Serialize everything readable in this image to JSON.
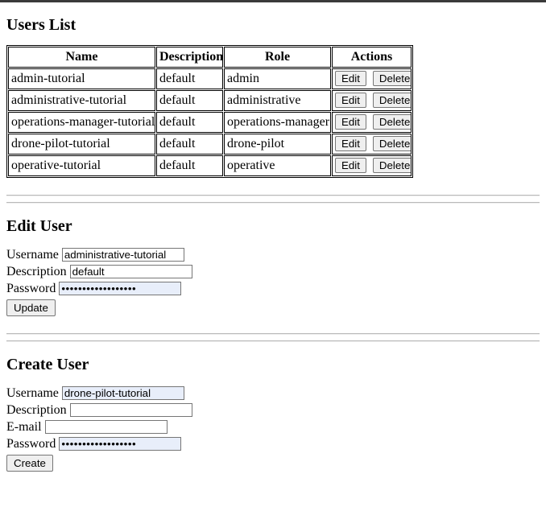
{
  "users_list": {
    "title": "Users List",
    "columns": [
      "Name",
      "Description",
      "Role",
      "Actions"
    ],
    "rows": [
      {
        "name": "admin-tutorial",
        "description": "default",
        "role": "admin",
        "edit_label": "Edit",
        "delete_label": "Delete"
      },
      {
        "name": "administrative-tutorial",
        "description": "default",
        "role": "administrative",
        "edit_label": "Edit",
        "delete_label": "Delete"
      },
      {
        "name": "operations-manager-tutorial",
        "description": "default",
        "role": "operations-manager",
        "edit_label": "Edit",
        "delete_label": "Delete"
      },
      {
        "name": "drone-pilot-tutorial",
        "description": "default",
        "role": "drone-pilot",
        "edit_label": "Edit",
        "delete_label": "Delete"
      },
      {
        "name": "operative-tutorial",
        "description": "default",
        "role": "operative",
        "edit_label": "Edit",
        "delete_label": "Delete"
      }
    ]
  },
  "edit_user": {
    "title": "Edit User",
    "fields": {
      "username": {
        "label": "Username",
        "value": "administrative-tutorial",
        "placeholder": ""
      },
      "description": {
        "label": "Description",
        "value": "default",
        "placeholder": ""
      },
      "password": {
        "label": "Password",
        "value": "••••••••••••••••••",
        "placeholder": ""
      }
    },
    "submit_label": "Update"
  },
  "create_user": {
    "title": "Create User",
    "fields": {
      "username": {
        "label": "Username",
        "value": "drone-pilot-tutorial",
        "placeholder": ""
      },
      "description": {
        "label": "Description",
        "value": "",
        "placeholder": ""
      },
      "email": {
        "label": "E-mail",
        "value": "",
        "placeholder": ""
      },
      "password": {
        "label": "Password",
        "value": "••••••••••••••••••",
        "placeholder": ""
      }
    },
    "submit_label": "Create"
  },
  "colors": {
    "chrome_bar": "#3b3b3b",
    "autofill_background": "#e8eefa",
    "button_background": "#efefef",
    "border": "#767676",
    "rule": "#b9b9b9"
  }
}
